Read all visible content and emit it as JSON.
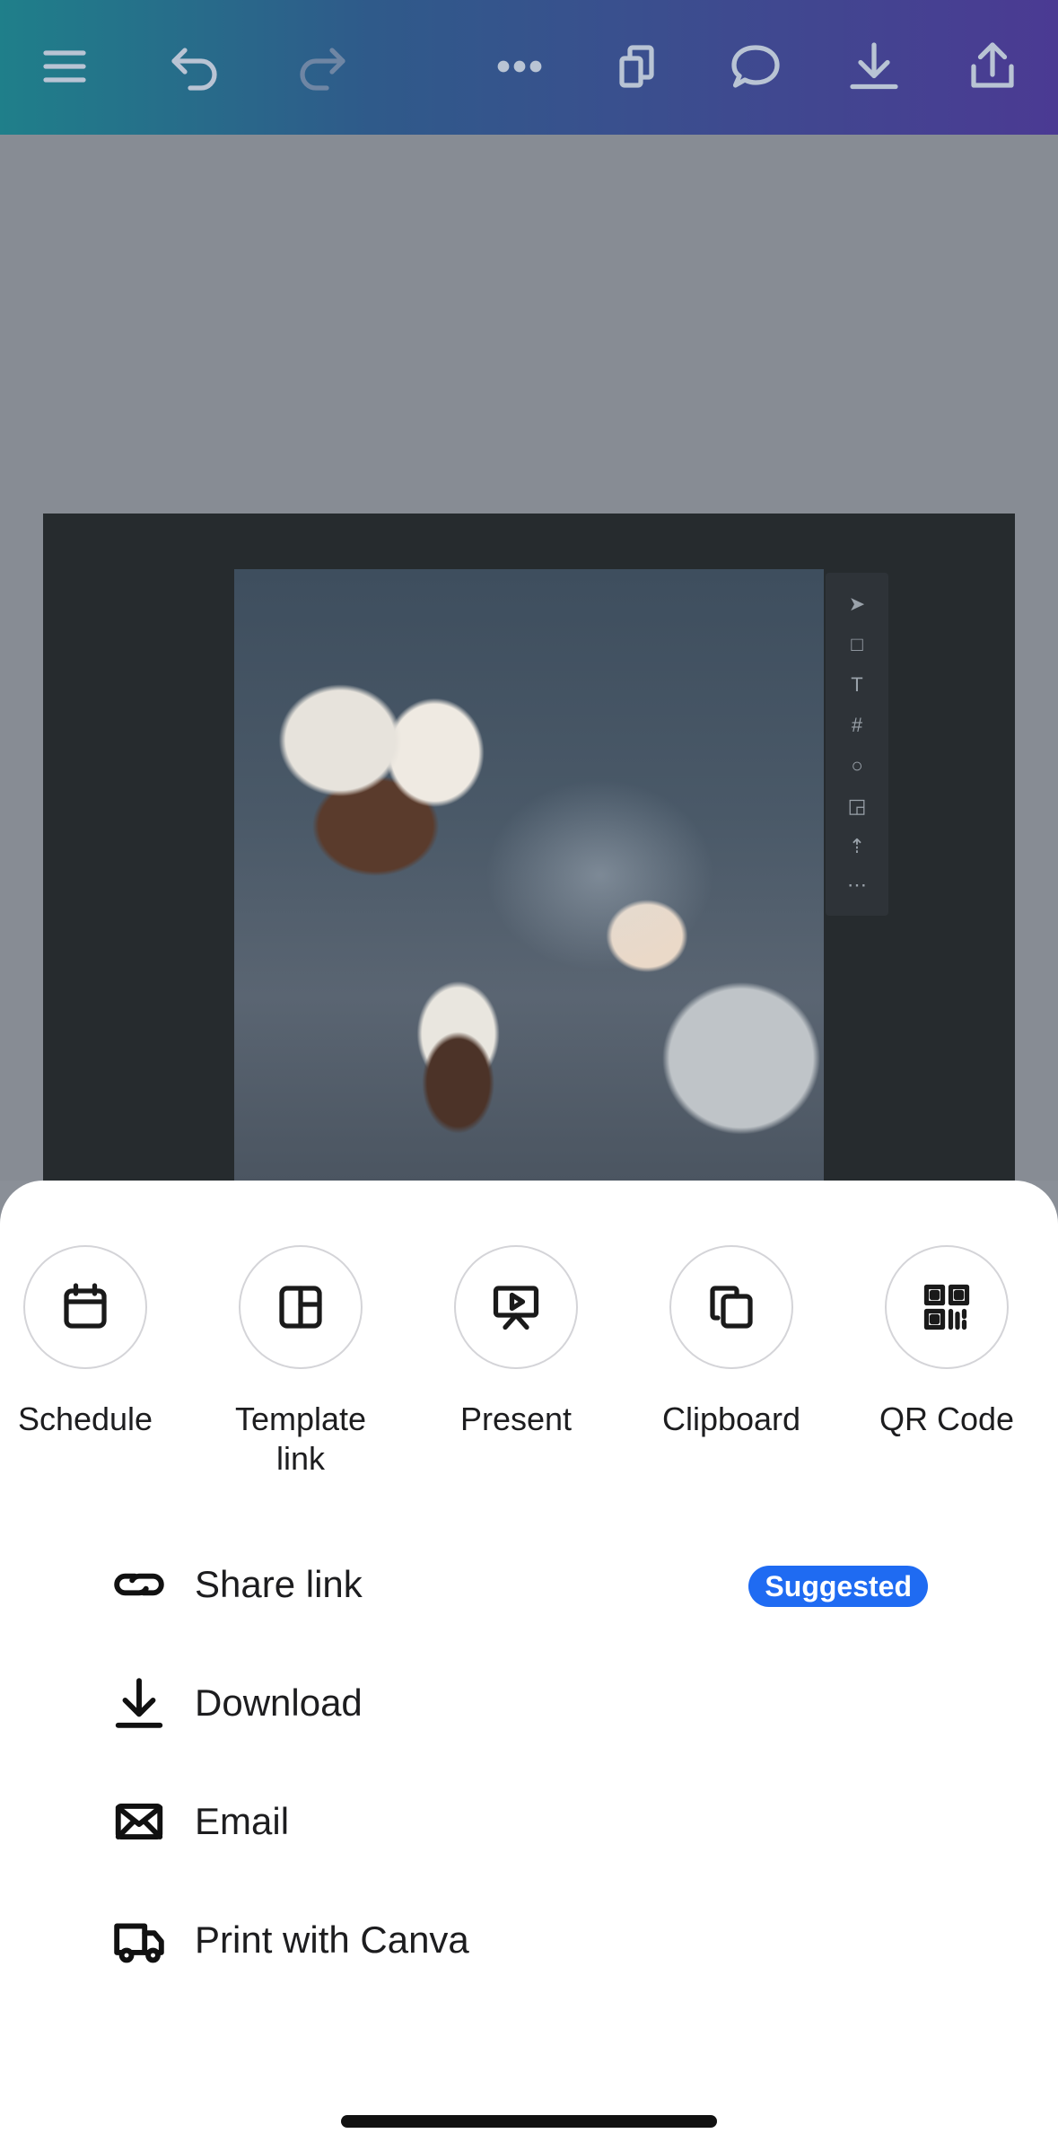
{
  "toolbar": {
    "icons": [
      "menu-icon",
      "undo-icon",
      "redo-icon",
      "more-icon",
      "pages-icon",
      "comment-icon",
      "download-icon",
      "share-icon"
    ]
  },
  "canvas": {
    "mini_toolbar_icons": [
      "cursor-icon",
      "frame-icon",
      "text-icon",
      "grid-icon",
      "shape-icon",
      "sticky-icon",
      "upload-icon",
      "more-icon"
    ]
  },
  "share_sheet": {
    "options": [
      {
        "label": "Schedule",
        "icon": "calendar-icon"
      },
      {
        "label": "Template\nlink",
        "icon": "template-icon"
      },
      {
        "label": "Present",
        "icon": "present-icon"
      },
      {
        "label": "Clipboard",
        "icon": "copy-icon"
      },
      {
        "label": "QR Code",
        "icon": "qr-code-icon"
      }
    ],
    "rows": [
      {
        "label": "Share link",
        "icon": "link-icon",
        "badge": "Suggested"
      },
      {
        "label": "Download",
        "icon": "download-icon"
      },
      {
        "label": "Email",
        "icon": "mail-icon"
      },
      {
        "label": "Print with Canva",
        "icon": "truck-icon"
      }
    ]
  },
  "colors": {
    "badge": "#1f6bf2",
    "overlay": "#878c94"
  }
}
